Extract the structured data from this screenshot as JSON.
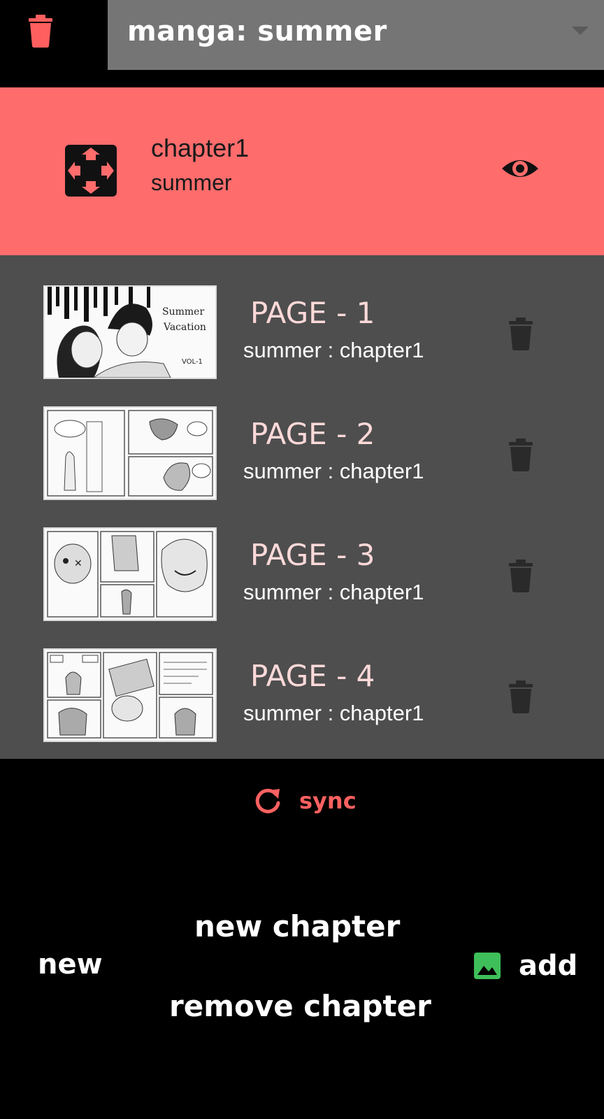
{
  "header": {
    "manga_label": "manga:  summer",
    "selector_value": "summer"
  },
  "chapter": {
    "name": "chapter1",
    "manga": "summer"
  },
  "pages": [
    {
      "title": "PAGE - 1",
      "subtitle": "summer : chapter1"
    },
    {
      "title": "PAGE - 2",
      "subtitle": "summer : chapter1"
    },
    {
      "title": "PAGE - 3",
      "subtitle": "summer : chapter1"
    },
    {
      "title": "PAGE - 4",
      "subtitle": "summer : chapter1"
    }
  ],
  "sync": {
    "label": "sync"
  },
  "actions": {
    "new_label": "new",
    "new_chapter_label": "new chapter",
    "remove_chapter_label": "remove chapter",
    "add_label": "add"
  },
  "icons": {
    "top_trash": "trash-icon",
    "chapter": "chapter-icon",
    "view": "eye-icon",
    "page_trash": "trash-icon",
    "sync": "refresh-icon",
    "add": "image-icon"
  },
  "colors": {
    "accent": "#ff6c6c",
    "sync": "#ff6161",
    "add_icon": "#3fbf5a",
    "list_bg": "#4e4e4e",
    "page_title": "#ffd9d9"
  }
}
